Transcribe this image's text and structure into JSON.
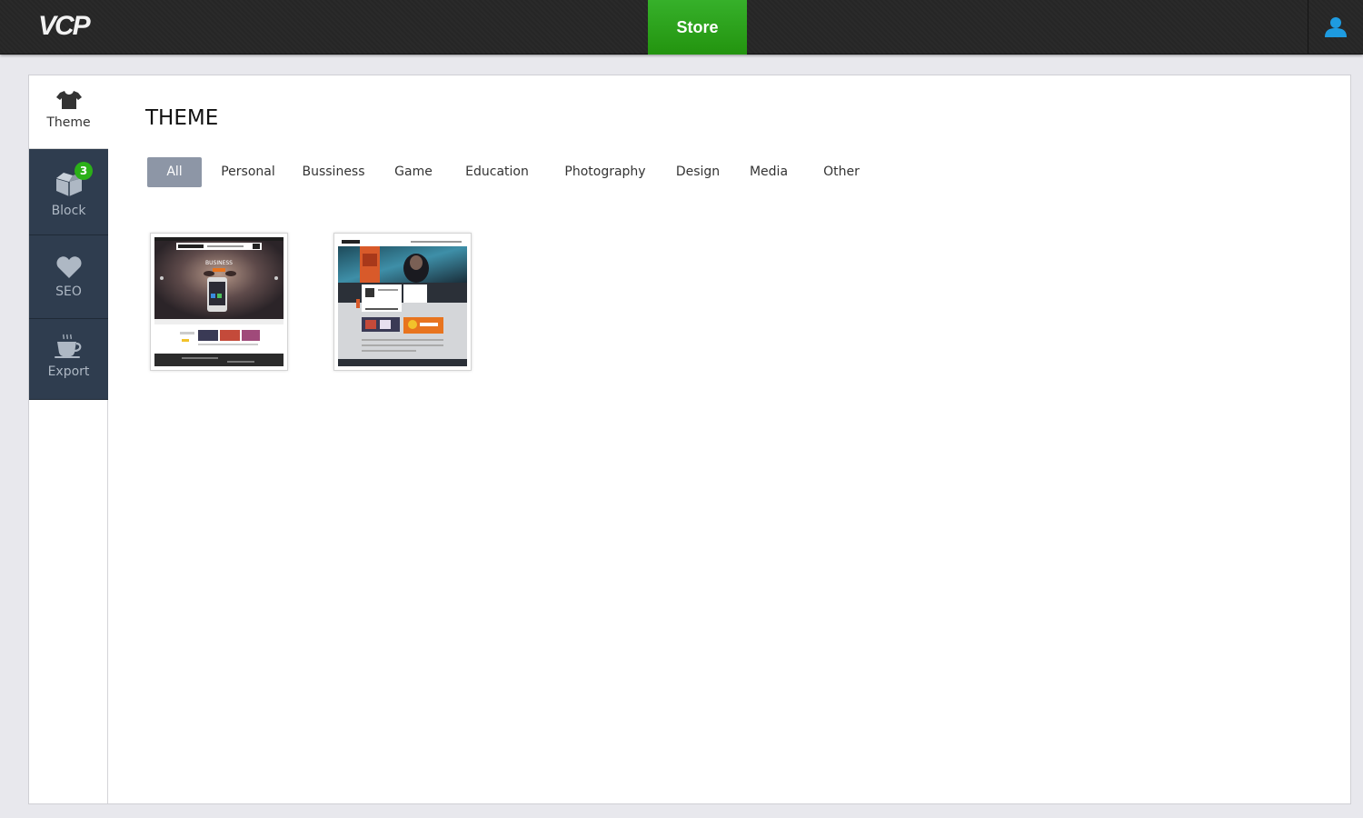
{
  "app": {
    "logo": "VCP"
  },
  "topbar": {
    "store_label": "Store",
    "user_icon": "user-icon"
  },
  "sidebar": {
    "items": [
      {
        "label": "Theme",
        "icon": "tshirt-icon",
        "active": true
      },
      {
        "label": "Block",
        "icon": "box-icon",
        "badge": "3"
      },
      {
        "label": "SEO",
        "icon": "heart-icon"
      },
      {
        "label": "Export",
        "icon": "coffee-cup-icon"
      }
    ]
  },
  "main": {
    "title": "THEME",
    "filters": [
      "All",
      "Personal",
      "Bussiness",
      "Game",
      "Education",
      "Photography",
      "Design",
      "Media",
      "Other"
    ],
    "active_filter": "All",
    "themes": [
      {
        "thumb_label": "BUSINESS",
        "style": "business"
      },
      {
        "thumb_label": "",
        "style": "game"
      }
    ]
  },
  "colors": {
    "accent_green": "#2ba61c",
    "sidebar_bg": "#2f3d4f",
    "filter_active": "#8d96a6",
    "user_icon": "#1e9be0"
  }
}
